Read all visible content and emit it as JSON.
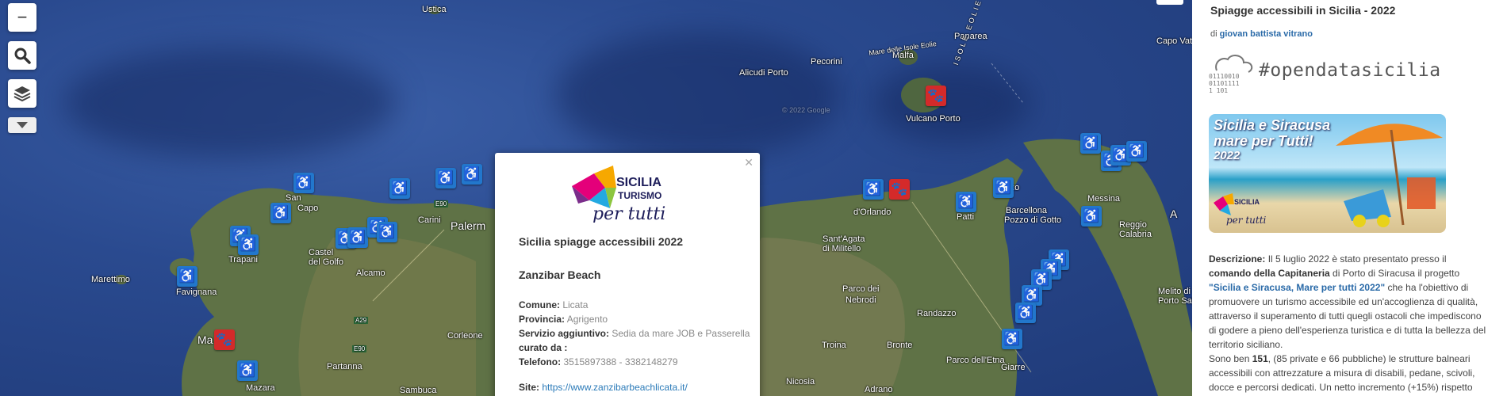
{
  "map": {
    "places": [
      {
        "name": "Ustica",
        "cls": ""
      },
      {
        "name": "Alicudi Porto",
        "cls": ""
      },
      {
        "name": "Pecorini",
        "cls": ""
      },
      {
        "name": "Malfa",
        "cls": ""
      },
      {
        "name": "Panarea",
        "cls": ""
      },
      {
        "name": "Capo Vat",
        "cls": ""
      },
      {
        "name": "Vulcano Porto",
        "cls": ""
      },
      {
        "name": "Mare delle Isole Eolie",
        "cls": ""
      },
      {
        "name": "ISOLE EOLIE",
        "cls": ""
      },
      {
        "name": "Palerm",
        "cls": "big"
      },
      {
        "name": "Carini",
        "cls": ""
      },
      {
        "name": "San",
        "cls": ""
      },
      {
        "name": "Capo",
        "cls": ""
      },
      {
        "name": "Trapani",
        "cls": ""
      },
      {
        "name": "Castel",
        "cls": ""
      },
      {
        "name": "del Golfo",
        "cls": ""
      },
      {
        "name": "Alcamo",
        "cls": ""
      },
      {
        "name": "Marettimo",
        "cls": ""
      },
      {
        "name": "Favignana",
        "cls": ""
      },
      {
        "name": "Corleone",
        "cls": ""
      },
      {
        "name": "Partanna",
        "cls": ""
      },
      {
        "name": "Sambuca",
        "cls": ""
      },
      {
        "name": "Ma",
        "cls": "big"
      },
      {
        "name": "d'Orlando",
        "cls": ""
      },
      {
        "name": "Sant'Agata",
        "cls": ""
      },
      {
        "name": "di Militello",
        "cls": ""
      },
      {
        "name": "Patti",
        "cls": ""
      },
      {
        "name": "Barcellona",
        "cls": ""
      },
      {
        "name": "Pozzo di Gotto",
        "cls": ""
      },
      {
        "name": "Messina",
        "cls": ""
      },
      {
        "name": "Reggio",
        "cls": ""
      },
      {
        "name": "Calabria",
        "cls": ""
      },
      {
        "name": "Parco dei",
        "cls": ""
      },
      {
        "name": "Nebrodi",
        "cls": ""
      },
      {
        "name": "Randazzo",
        "cls": ""
      },
      {
        "name": "Troina",
        "cls": ""
      },
      {
        "name": "Bronte",
        "cls": ""
      },
      {
        "name": "Parco dell'Etna",
        "cls": ""
      },
      {
        "name": "Nicosia",
        "cls": ""
      },
      {
        "name": "Adrano",
        "cls": ""
      },
      {
        "name": "Giarre",
        "cls": ""
      },
      {
        "name": "Melito di",
        "cls": ""
      },
      {
        "name": "Porto Sal",
        "cls": ""
      },
      {
        "name": "Mazara",
        "cls": ""
      },
      {
        "name": "azzo",
        "cls": ""
      },
      {
        "name": "A",
        "cls": "big"
      },
      {
        "name": "E90",
        "cls": ""
      },
      {
        "name": "A29",
        "cls": ""
      },
      {
        "name": "E90",
        "cls": ""
      }
    ],
    "watermark": "© 2022 Google"
  },
  "controls": {
    "zoom_out": "−"
  },
  "popup": {
    "logo": {
      "line1": "SICILIA",
      "line2": "TURISMO",
      "line3": "per tutti"
    },
    "title": "Sicilia spiagge accessibili 2022",
    "name": "Zanzibar Beach",
    "rows": [
      {
        "label": "Comune:",
        "value": "Licata"
      },
      {
        "label": "Provincia:",
        "value": "Agrigento"
      },
      {
        "label": "Servizio aggiuntivo:",
        "value": "Sedia da mare JOB e Passerella"
      },
      {
        "label": "curato da :",
        "value": ""
      },
      {
        "label": "Telefono:",
        "value": "3515897388 - 3382148279"
      }
    ],
    "site_label": "Site:",
    "site_url": "https://www.zanzibarbeachlicata.it/"
  },
  "sidebar": {
    "title": "Spiagge accessibili in Sicilia - 2022",
    "author_prefix": "di",
    "author": "giovan battista vitrano",
    "binary": [
      "01110010",
      "01101111",
      "1  101"
    ],
    "hashtag": "#opendatasicilia",
    "banner": {
      "line1": "Sicilia e Siracusa",
      "line2": "mare per Tutti!",
      "year": "2022",
      "logo1": "SICILIA",
      "logo2": "per tutti"
    },
    "desc": {
      "label": "Descrizione:",
      "t1": " Il 5 luglio 2022 è stato presentato presso il ",
      "b1": "comando della Capitaneria",
      "t2": " di Porto di Siracusa il progetto ",
      "link": "\"Sicilia e Siracusa, Mare per tutti 2022\"",
      "t3": " che ha l'obiettivo di promuovere un turismo accessibile ed un'accoglienza di qualità, attraverso il superamento di tutti quegli ostacoli che impediscono di godere a pieno dell'esperienza turistica e di tutta la bellezza del territorio siciliano.",
      "t4": "Sono ben ",
      "b2": "151",
      "t5": ", (85 private e 66 pubbliche) le strutture balneari accessibili con attrezzature a misura di disabili, pedane, scivoli, docce e percorsi dedicati. Un netto incremento (+15%) rispetto"
    }
  }
}
